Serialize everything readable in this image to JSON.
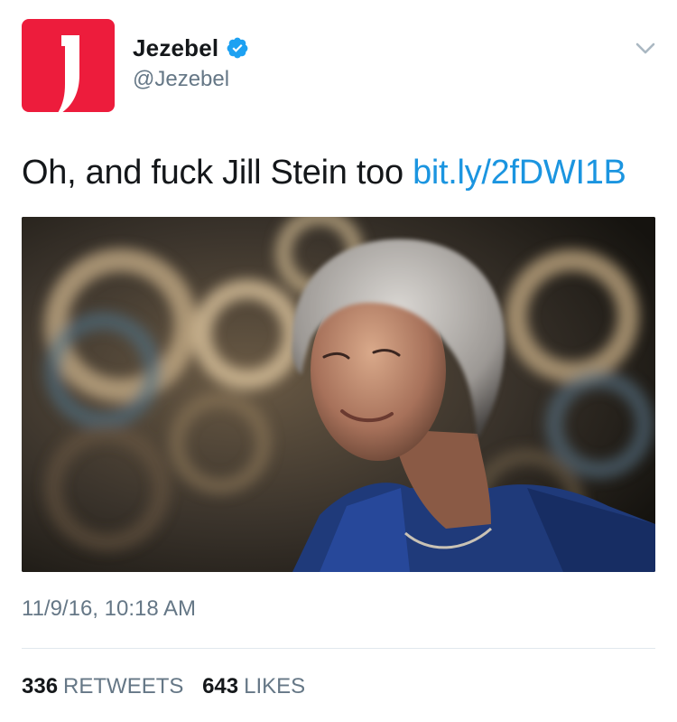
{
  "account": {
    "display_name": "Jezebel",
    "handle": "@Jezebel",
    "verified": true,
    "avatar_color": "#ed1c3c",
    "avatar_icon": "jezebel-logo-icon"
  },
  "tweet": {
    "text": "Oh, and fuck Jill Stein too ",
    "link_text": "bit.ly/2fDWI1B",
    "timestamp": "11/9/16, 10:18 AM"
  },
  "stats": {
    "retweets_count": "336",
    "retweets_label": "RETWEETS",
    "likes_count": "643",
    "likes_label": "LIKES"
  },
  "icons": {
    "verified": "verified-badge-icon",
    "menu": "chevron-down-icon"
  },
  "colors": {
    "link": "#1b95e0",
    "secondary_text": "#657786",
    "primary_text": "#14171a",
    "verified": "#1da1f2"
  }
}
